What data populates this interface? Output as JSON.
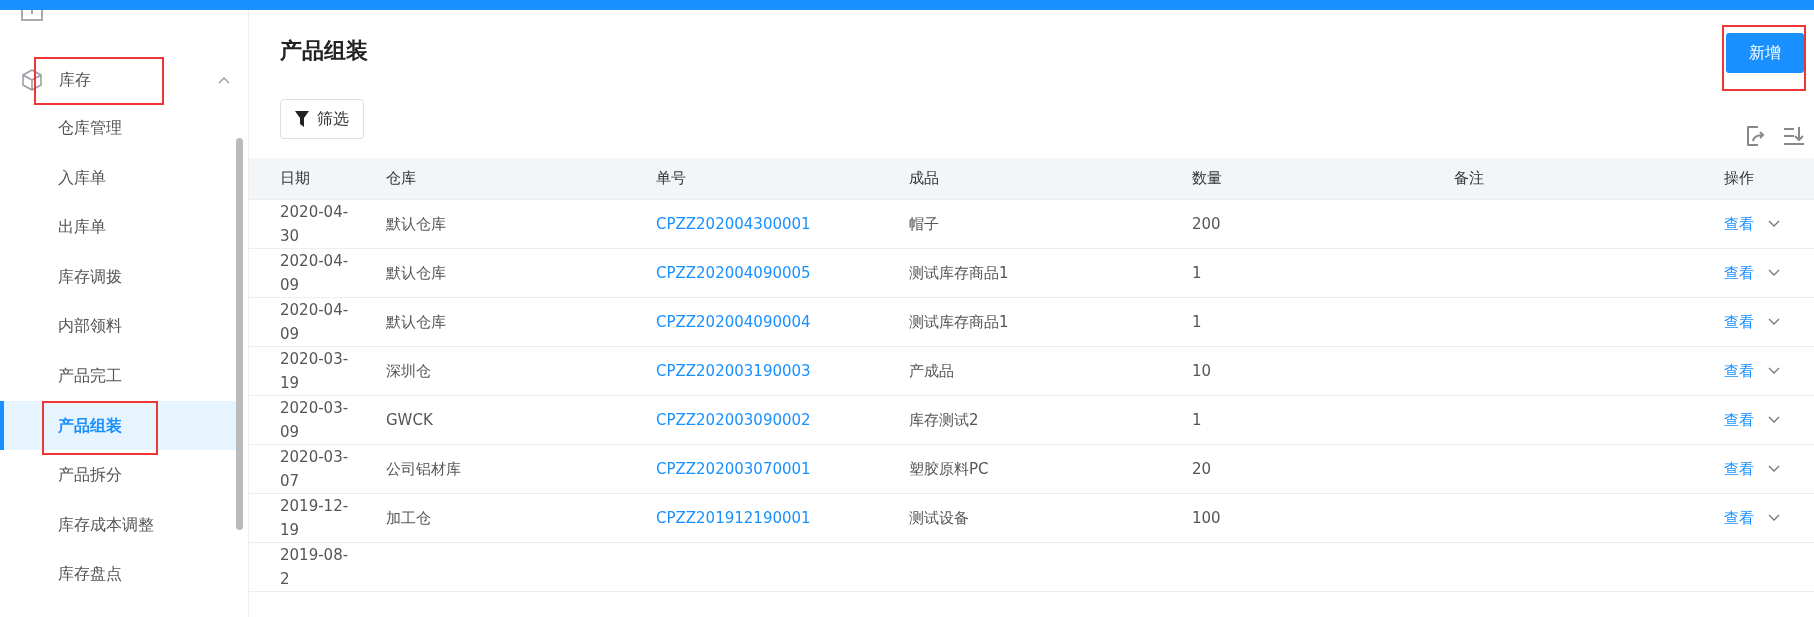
{
  "sidebar": {
    "group": {
      "label": "库存",
      "expanded": true,
      "highlighted": true
    },
    "items": [
      {
        "label": "仓库管理",
        "selected": false,
        "highlighted": false
      },
      {
        "label": "入库单",
        "selected": false,
        "highlighted": false
      },
      {
        "label": "出库单",
        "selected": false,
        "highlighted": false
      },
      {
        "label": "库存调拨",
        "selected": false,
        "highlighted": false
      },
      {
        "label": "内部领料",
        "selected": false,
        "highlighted": false
      },
      {
        "label": "产品完工",
        "selected": false,
        "highlighted": false
      },
      {
        "label": "产品组装",
        "selected": true,
        "highlighted": true
      },
      {
        "label": "产品拆分",
        "selected": false,
        "highlighted": false
      },
      {
        "label": "库存成本调整",
        "selected": false,
        "highlighted": false
      },
      {
        "label": "库存盘点",
        "selected": false,
        "highlighted": false
      }
    ]
  },
  "page": {
    "title": "产品组装",
    "add_button": {
      "label": "新增",
      "highlighted": true
    },
    "filter_button": "筛选"
  },
  "table": {
    "columns": [
      "日期",
      "仓库",
      "单号",
      "成品",
      "数量",
      "备注",
      "操作"
    ],
    "rows": [
      {
        "date": "2020-04-30",
        "warehouse": "默认仓库",
        "number": "CPZZ202004300001",
        "product": "帽子",
        "quantity": "200",
        "action": "查看"
      },
      {
        "date": "2020-04-09",
        "warehouse": "默认仓库",
        "number": "CPZZ202004090005",
        "product": "测试库存商品1",
        "quantity": "1",
        "action": "查看"
      },
      {
        "date": "2020-04-09",
        "warehouse": "默认仓库",
        "number": "CPZZ202004090004",
        "product": "测试库存商品1",
        "quantity": "1",
        "action": "查看"
      },
      {
        "date": "2020-03-19",
        "warehouse": "深圳仓",
        "number": "CPZZ202003190003",
        "product": "产成品",
        "quantity": "10",
        "action": "查看"
      },
      {
        "date": "2020-03-09",
        "warehouse": "GWCK",
        "number": "CPZZ202003090002",
        "product": "库存测试2",
        "quantity": "1",
        "action": "查看"
      },
      {
        "date": "2020-03-07",
        "warehouse": "公司铝材库",
        "number": "CPZZ202003070001",
        "product": "塑胶原料PC",
        "quantity": "20",
        "action": "查看"
      },
      {
        "date": "2019-12-19",
        "warehouse": "加工仓",
        "number": "CPZZ201912190001",
        "product": "测试设备",
        "quantity": "100",
        "action": "查看"
      },
      {
        "date": "2019-08-2"
      }
    ]
  }
}
